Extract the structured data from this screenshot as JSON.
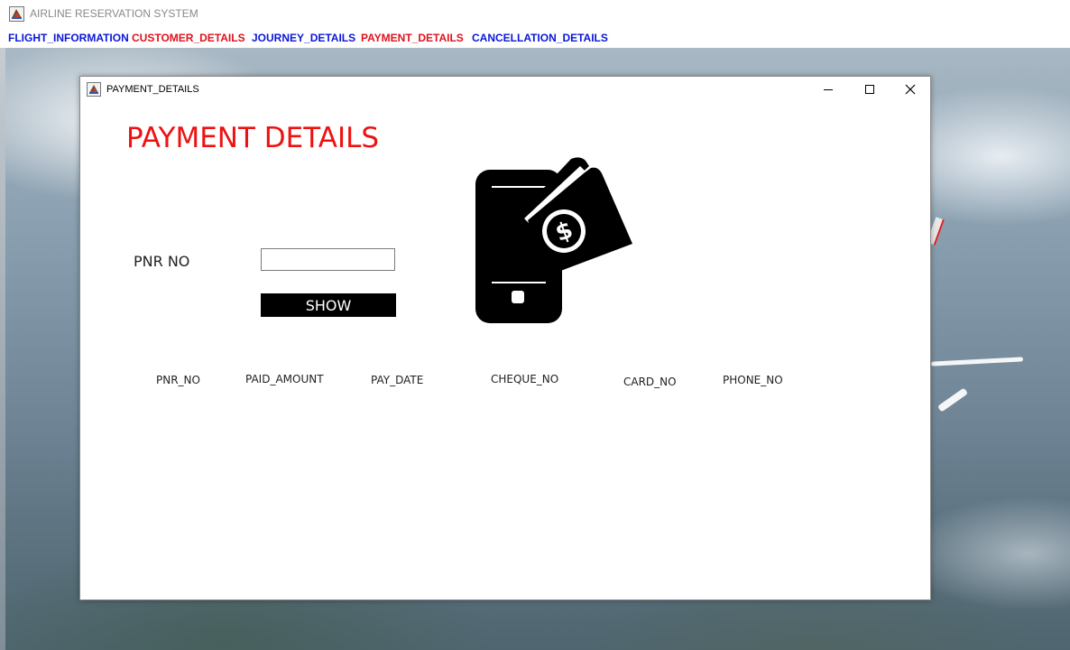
{
  "app": {
    "title": "AIRLINE RESERVATION SYSTEM"
  },
  "menu": {
    "items": [
      {
        "label": "FLIGHT_INFORMATION",
        "color": "#0a17d8"
      },
      {
        "label": "CUSTOMER_DETAILS",
        "color": "#e0111c"
      },
      {
        "label": "JOURNEY_DETAILS",
        "color": "#0a17d8"
      },
      {
        "label": "PAYMENT_DETAILS",
        "color": "#e0111c"
      },
      {
        "label": "CANCELLATION_DETAILS",
        "color": "#0a17d8"
      }
    ]
  },
  "frame": {
    "title": "PAYMENT_DETAILS",
    "heading": "PAYMENT DETAILS",
    "heading_color": "#ee1111",
    "pnr_label": "PNR NO",
    "pnr_value": "",
    "show_label": "SHOW",
    "icon": "mobile-payment-icon",
    "columns": [
      "PNR_NO",
      "PAID_AMOUNT",
      "PAY_DATE",
      "CHEQUE_NO",
      "CARD_NO",
      "PHONE_NO"
    ]
  }
}
